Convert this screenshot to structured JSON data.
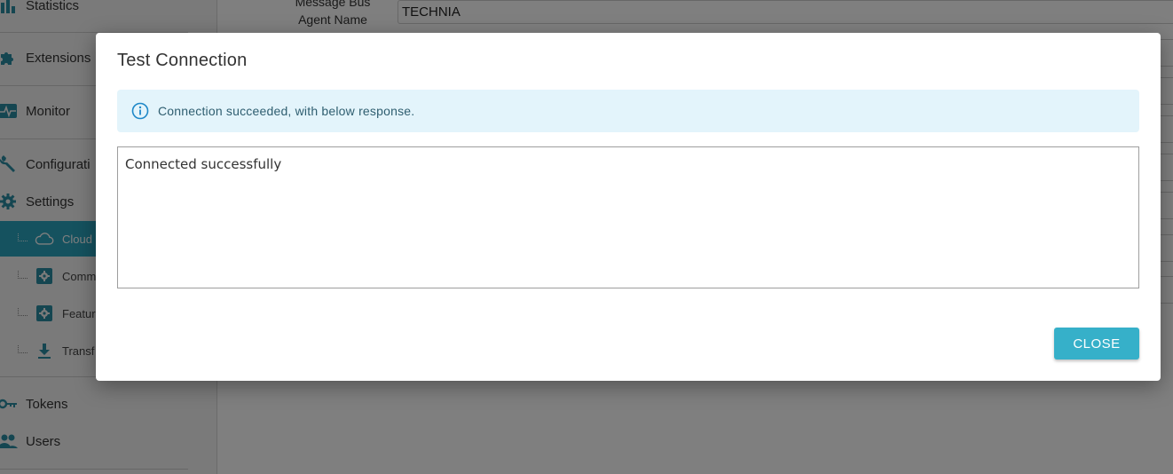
{
  "sidebar": {
    "items": [
      {
        "label": "Statistics",
        "icon": "bar-chart-icon"
      },
      {
        "label": "Extensions",
        "icon": "puzzle-icon"
      },
      {
        "label": "Monitor",
        "icon": "pulse-icon"
      },
      {
        "label": "Configurati",
        "icon": "wrench-icon"
      },
      {
        "label": "Settings",
        "icon": "gear-icon"
      }
    ],
    "sub_items": [
      {
        "label": "Cloud",
        "icon": "cloud-icon",
        "active": true
      },
      {
        "label": "Comm",
        "icon": "gear-box-icon"
      },
      {
        "label": "Featur",
        "icon": "gear-box-icon"
      },
      {
        "label": "Transf",
        "icon": "download-icon"
      }
    ],
    "bottom_items": [
      {
        "label": "Tokens",
        "icon": "key-icon"
      },
      {
        "label": "Users",
        "icon": "users-icon"
      }
    ]
  },
  "main": {
    "field_label_line1": "Message Bus",
    "field_label_line2": "Agent Name",
    "field_value": "TECHNIA"
  },
  "modal": {
    "title": "Test Connection",
    "info_message": "Connection succeeded, with below response.",
    "response_text": "Connected successfully",
    "close_label": "CLOSE"
  },
  "colors": {
    "accent": "#36b0c9",
    "info_bg": "#e3f4fb",
    "info_icon": "#1e88c8",
    "sidebar_icon": "#2a8ca3"
  }
}
